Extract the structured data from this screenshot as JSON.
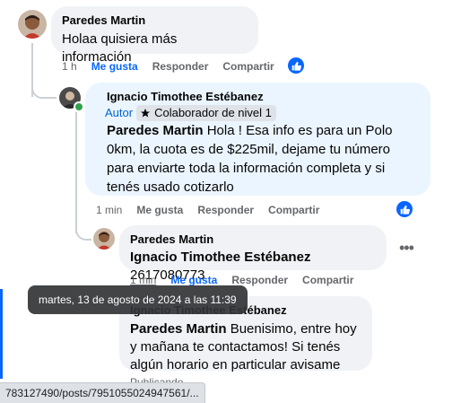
{
  "comments": [
    {
      "author": "Paredes Martin",
      "text": "Holaa quisiera más información",
      "actions": {
        "time": "1 h",
        "like": "Me gusta",
        "reply": "Responder",
        "share": "Compartir"
      }
    },
    {
      "author": "Ignacio Timothee Estébanez",
      "badge_author": "Autor",
      "badge_level": "Colaborador de nivel 1",
      "mention": "Paredes Martin",
      "text": " Hola ! Esa info es para un Polo 0km, la cuota es de $225mil, dejame tu número para enviarte toda la información completa y si tenés usado cotizarlo",
      "actions": {
        "time": "1 min",
        "like": "Me gusta",
        "reply": "Responder",
        "share": "Compartir"
      }
    },
    {
      "author": "Paredes Martin",
      "mention": "Ignacio Timothee Estébanez",
      "text": " 2617080773",
      "actions": {
        "time": "1 min",
        "like": "Me gusta",
        "reply": "Responder",
        "share": "Compartir"
      }
    },
    {
      "author": "Ignacio Timothee Estébanez",
      "mention": "Paredes Martin",
      "text": " Buenisimo, entre hoy y mañana te contactamos! Si tenés algún horario en particular avisame",
      "status": "Publicando..."
    }
  ],
  "tooltip": "martes, 13 de agosto de 2024 a las 11:39",
  "status_url": "783127490/posts/7951055024947561/...",
  "colors": {
    "accent": "#0866ff",
    "bubble_grey": "#f0f2f5",
    "bubble_blue": "#ebf5ff",
    "meta_grey": "#65676b",
    "online": "#31a24c"
  },
  "icons": {
    "like_reaction": "thumbs-up-icon",
    "more": "more-horizontal-icon",
    "level_badge": "star-icon"
  }
}
